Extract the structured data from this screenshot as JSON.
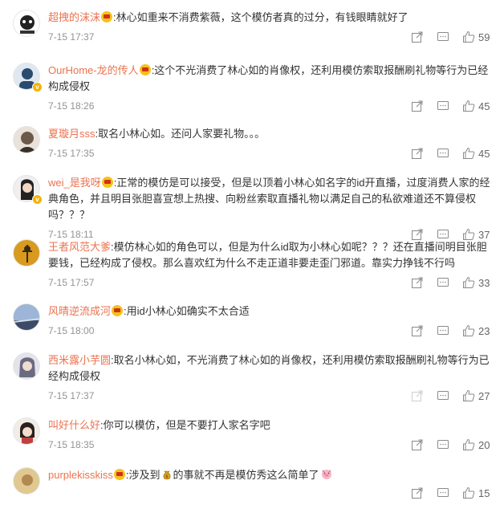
{
  "comments": [
    {
      "user": "超拽的沫沫",
      "text": ":林心如重来不消费紫薇，这个模仿者真的过分，有钱眼睛就好了",
      "time": "7-15 17:37",
      "likes": "59",
      "avatar_color": "#3a3a3a",
      "verified": false
    },
    {
      "user": "OurHome-龙的传人",
      "text": ":这个不光消费了林心如的肖像权，还利用模仿索取报酬刷礼物等行为已经构成侵权",
      "time": "7-15 18:26",
      "likes": "45",
      "avatar_color": "#2b4a6f",
      "verified": true
    },
    {
      "user": "夏璇月sss",
      "text": ":取名小林心如。还问人家要礼物。。。",
      "time": "7-15 17:35",
      "likes": "45",
      "avatar_color": "#6b5a4a",
      "verified": false
    },
    {
      "user": "wei_是我呀",
      "text": ":正常的模仿是可以接受，但是以顶着小林心如名字的id开直播，过度消费人家的经典角色，并且明目张胆喜宣想上热搜、向粉丝索取直播礼物以满足自己的私欲难道还不算侵权吗？？？",
      "time": "7-15 18:11",
      "likes": "37",
      "avatar_color": "#4a4a4a",
      "verified": true
    },
    {
      "user": "王者风范大爹",
      "text": ":模仿林心如的角色可以，但是为什么id取为小林心如呢？？？还在直播间明目张胆要钱，已经构成了侵权。那么喜欢红为什么不走正道非要走歪门邪道。靠实力挣钱不行吗",
      "time": "7-15 17:57",
      "likes": "33",
      "avatar_color": "#c98a1a",
      "verified": false
    },
    {
      "user": "风晴逆流成河",
      "text": ":用id小林心如确实不太合适",
      "time": "7-15 18:00",
      "likes": "23",
      "avatar_color": "#5a7aa6",
      "verified": false
    },
    {
      "user": "西米露小芋圆",
      "text": ":取名小林心如，不光消费了林心如的肖像权，还利用模仿索取报酬刷礼物等行为已经构成侵权",
      "time": "7-15 17:37",
      "likes": "27",
      "avatar_color": "#8a8aa0",
      "verified": false
    },
    {
      "user": "叫好什么好",
      "text": ":你可以模仿，但是不要打人家名字吧",
      "time": "7-15 18:35",
      "likes": "20",
      "avatar_color": "#3d3030",
      "verified": false
    },
    {
      "user": "purplekisskiss",
      "text": ":涉及到",
      "text_after_emoji": "的事就不再是模仿秀这么简单了",
      "time": "",
      "likes": "15",
      "avatar_color": "#c8a060",
      "verified": false
    }
  ],
  "icons": {
    "share": "share-icon",
    "comment": "comment-icon",
    "like": "thumbs-up-icon"
  },
  "colors": {
    "username": "#eb7350",
    "text": "#333333",
    "time": "#939393"
  }
}
